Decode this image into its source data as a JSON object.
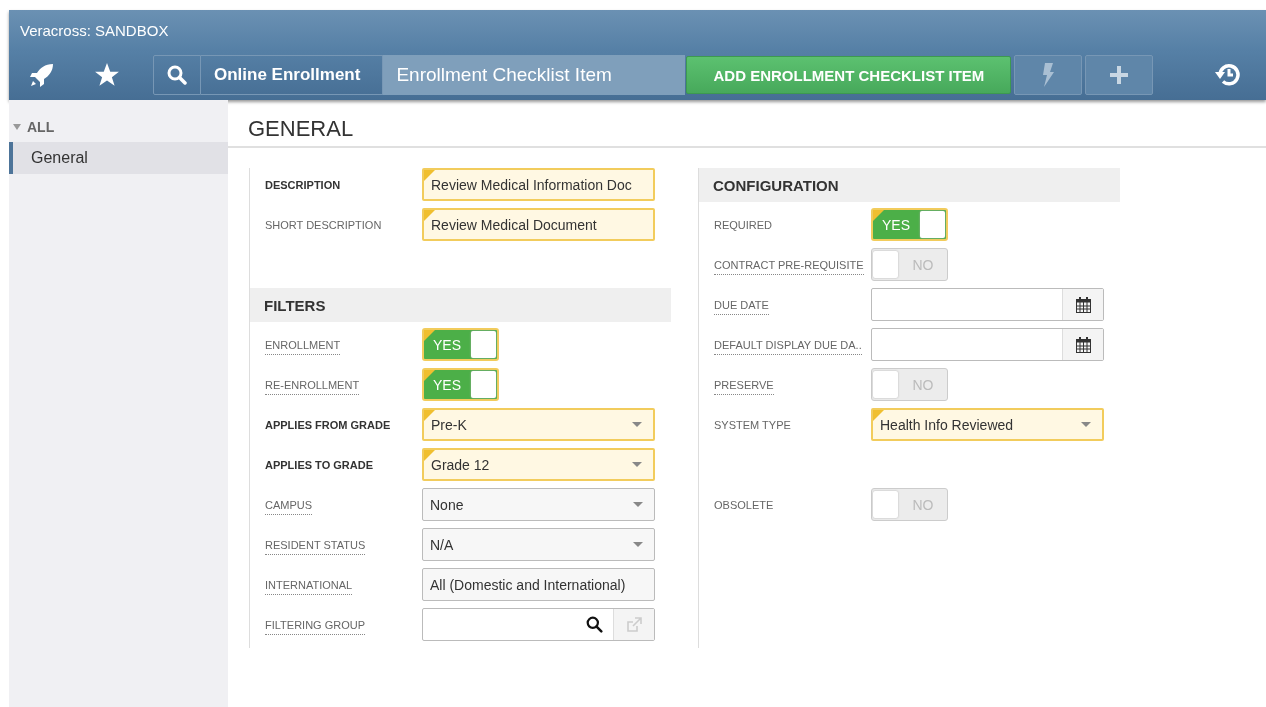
{
  "app_title": "Veracross: SANDBOX",
  "breadcrumb": {
    "module": "Online Enrollment",
    "page": "Enrollment Checklist Item"
  },
  "primary_action": "ADD ENROLLMENT CHECKLIST ITEM",
  "sidebar": {
    "group": {
      "label": "ALL",
      "expanded": true
    },
    "items": [
      {
        "label": "General",
        "selected": true
      }
    ]
  },
  "section_title": "GENERAL",
  "left_column": {
    "groups": [
      {
        "fields": [
          {
            "kind": "text",
            "label": "DESCRIPTION",
            "value": "Review Medical Information Doc",
            "required": true,
            "bold": true,
            "hint": false
          },
          {
            "kind": "text",
            "label": "SHORT DESCRIPTION",
            "value": "Review Medical Document",
            "required": true,
            "bold": false,
            "hint": false
          }
        ]
      },
      {
        "header": "FILTERS",
        "fields": [
          {
            "kind": "toggle",
            "label": "ENROLLMENT",
            "value": "YES",
            "on": true,
            "required": true,
            "bold": false,
            "hint": true
          },
          {
            "kind": "toggle",
            "label": "RE-ENROLLMENT",
            "value": "YES",
            "on": true,
            "required": true,
            "bold": false,
            "hint": true
          },
          {
            "kind": "select",
            "label": "APPLIES FROM GRADE",
            "value": "Pre-K",
            "required": true,
            "bold": true,
            "hint": false
          },
          {
            "kind": "select",
            "label": "APPLIES TO GRADE",
            "value": "Grade 12",
            "required": true,
            "bold": true,
            "hint": false
          },
          {
            "kind": "select",
            "label": "CAMPUS",
            "value": "None",
            "required": false,
            "bold": false,
            "hint": true
          },
          {
            "kind": "select",
            "label": "RESIDENT STATUS",
            "value": "N/A",
            "required": false,
            "bold": false,
            "hint": true
          },
          {
            "kind": "text",
            "label": "INTERNATIONAL",
            "value": "All (Domestic and International)",
            "required": false,
            "bold": false,
            "hint": true
          },
          {
            "kind": "lookup",
            "label": "FILTERING GROUP",
            "required": false,
            "bold": false,
            "hint": true
          }
        ]
      }
    ]
  },
  "right_column": {
    "groups": [
      {
        "header": "CONFIGURATION",
        "fields": [
          {
            "kind": "toggle",
            "label": "REQUIRED",
            "value": "YES",
            "on": true,
            "required": true,
            "bold": false,
            "hint": false
          },
          {
            "kind": "toggle",
            "label": "CONTRACT PRE-REQUISITE",
            "value": "NO",
            "on": false,
            "required": false,
            "bold": false,
            "hint": true
          },
          {
            "kind": "date",
            "label": "DUE DATE",
            "required": false,
            "bold": false,
            "hint": true
          },
          {
            "kind": "date",
            "label": "DEFAULT DISPLAY DUE DA..",
            "required": false,
            "bold": false,
            "hint": true
          },
          {
            "kind": "toggle",
            "label": "PRESERVE",
            "value": "NO",
            "on": false,
            "required": false,
            "bold": false,
            "hint": true
          },
          {
            "kind": "select",
            "label": "SYSTEM TYPE",
            "value": "Health Info Reviewed",
            "required": true,
            "bold": false,
            "hint": false
          },
          {
            "kind": "toggle",
            "label": "OBSOLETE",
            "value": "NO",
            "on": false,
            "required": false,
            "bold": false,
            "hint": false,
            "gap_before": true
          }
        ]
      }
    ]
  }
}
